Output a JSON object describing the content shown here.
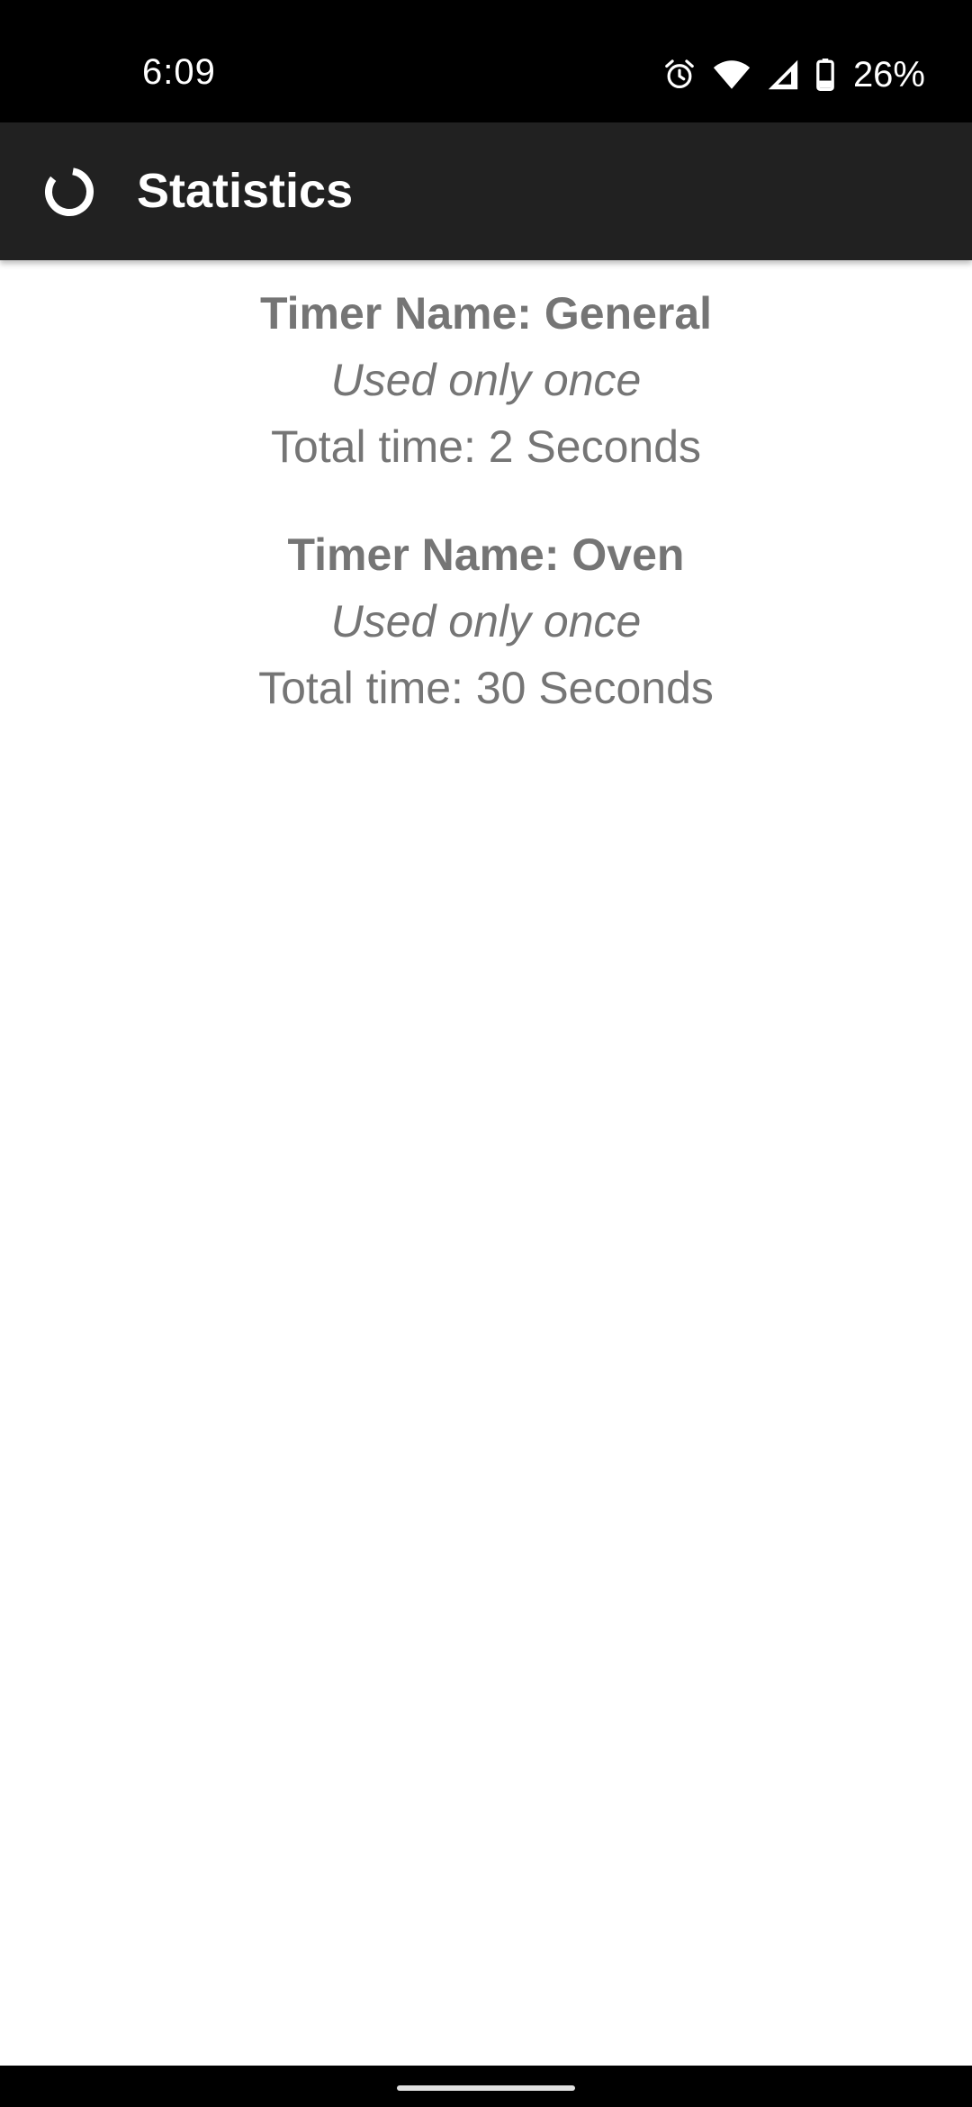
{
  "status_bar": {
    "time": "6:09",
    "battery_percent": "26%",
    "icons": [
      "alarm-icon",
      "wifi-icon",
      "signal-icon",
      "battery-icon"
    ]
  },
  "app_bar": {
    "title": "Statistics",
    "icon": "progress-ring-icon",
    "background": "#212121"
  },
  "stats": [
    {
      "name": "Timer Name: General",
      "usage": "Used only once",
      "total": "Total time: 2 Seconds"
    },
    {
      "name": "Timer Name: Oven",
      "usage": "Used only once",
      "total": "Total time: 30 Seconds"
    }
  ],
  "colors": {
    "text": "#757575",
    "status_bar": "#000000"
  }
}
